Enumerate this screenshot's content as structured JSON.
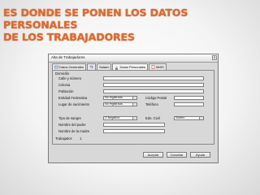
{
  "headline": {
    "line1": "ES DONDE SE PONEN LOS DATOS PERSONALES",
    "line2": "DE LOS TRABAJADORES"
  },
  "window": {
    "title": "Alta de Trabajadores",
    "close": "X"
  },
  "tabs": [
    {
      "label": "Datos Generales",
      "icon": "general-data-icon"
    },
    {
      "label": "",
      "icon": "refresh-icon"
    },
    {
      "label": "Salario",
      "icon": ""
    },
    {
      "label": "Datos Personales",
      "icon": "person-icon",
      "active": true
    },
    {
      "label": "IMSS",
      "icon": "document-icon"
    }
  ],
  "form": {
    "group_title": "Domicilio",
    "calle_label": "Calle y número",
    "colonia_label": "Colonia",
    "poblacion_label": "Población",
    "entidad_label": "Entidad Federativa",
    "entidad_value": "No registrada",
    "codigo_postal_label": "Código Postal",
    "lugar_nacimiento_label": "Lugar de nacimiento",
    "lugar_nacimiento_value": "No registrada",
    "telefono_label": "Teléfono",
    "tipo_sangre_label": "Tipo de sangre",
    "tipo_sangre_value": "O Negativa",
    "edo_civil_label": "Edo. Civil",
    "edo_civil_value": "Soltero",
    "padre_label": "Nombre del padre",
    "madre_label": "Nombre de la madre"
  },
  "footer": {
    "trabajador_label": "Trabajador:",
    "trabajador_value": "1",
    "accept": "Aceptar",
    "cancel": "Cancelar",
    "help": "Ayuda"
  }
}
